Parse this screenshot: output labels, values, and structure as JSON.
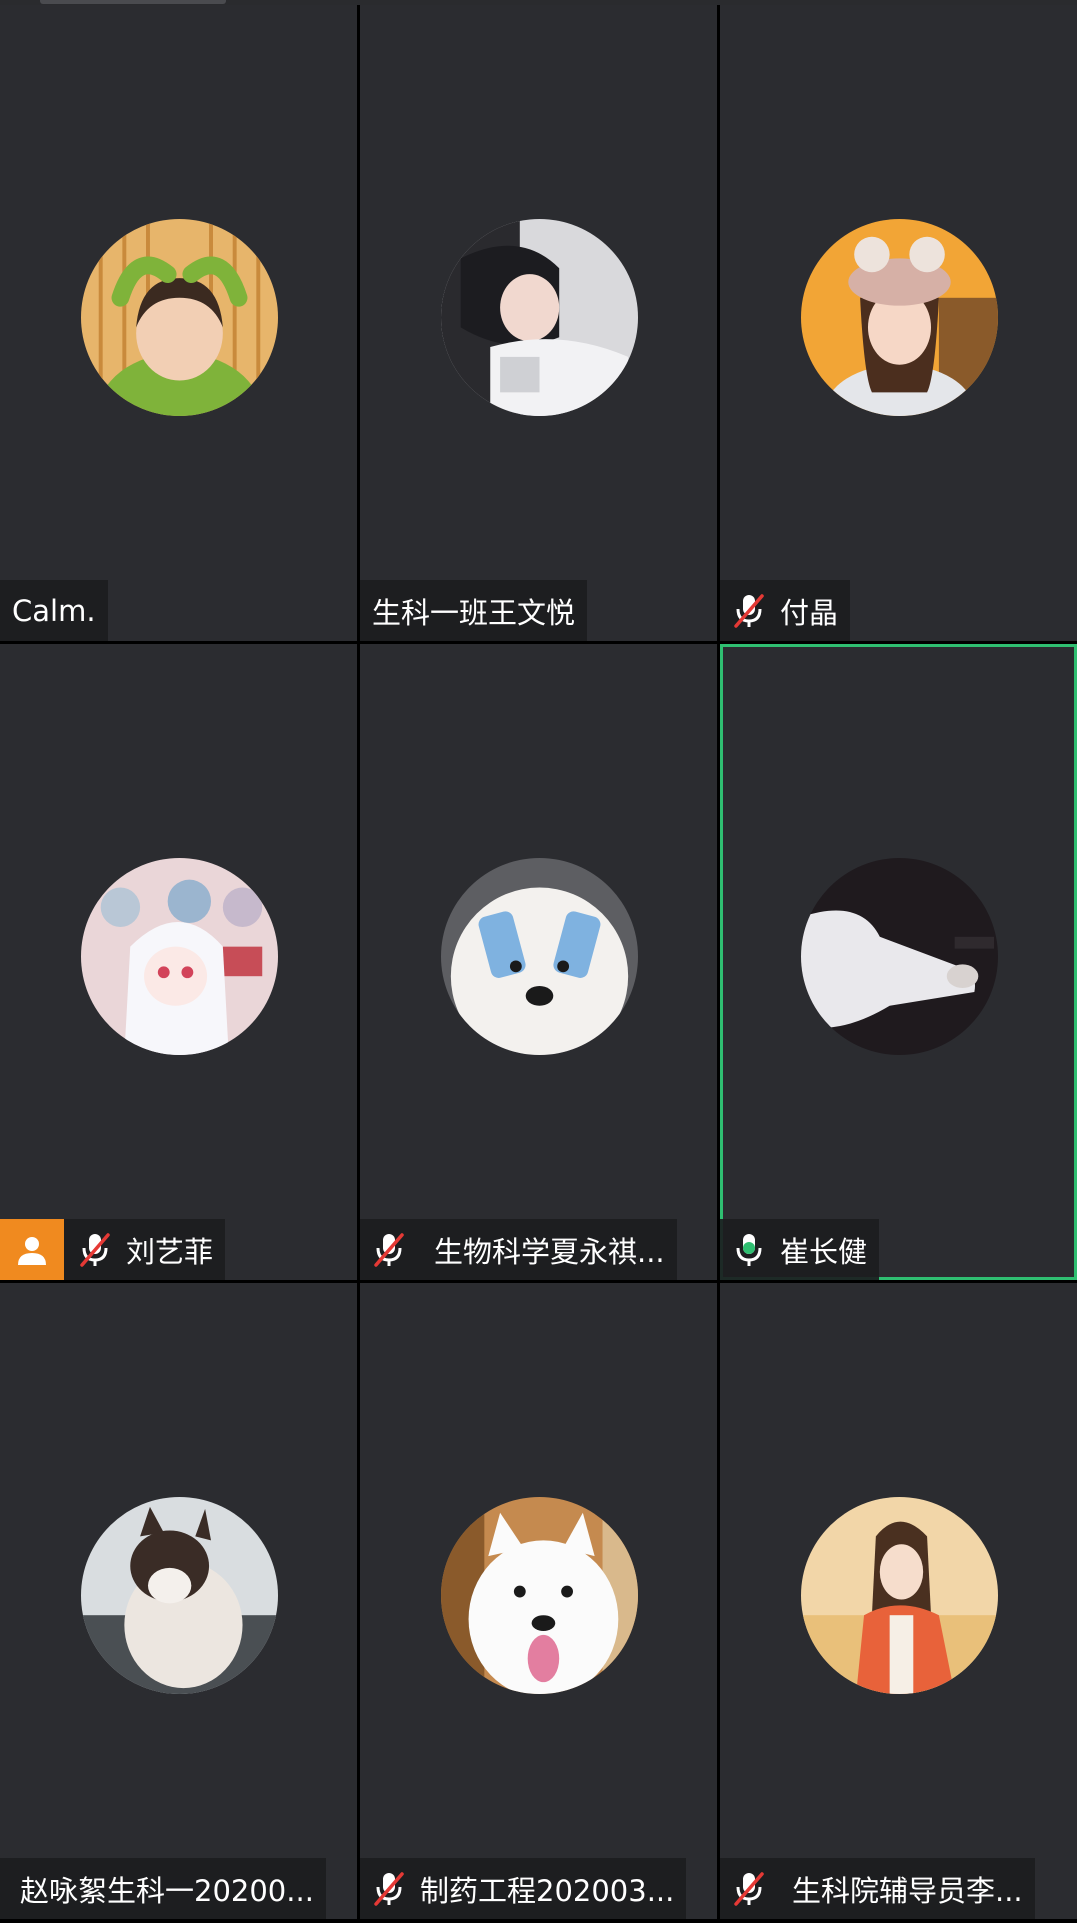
{
  "participants": [
    {
      "name": "Calm.",
      "mic": "none",
      "host": false,
      "speaking": false
    },
    {
      "name": "生科一班王文悦",
      "mic": "none",
      "host": false,
      "speaking": false
    },
    {
      "name": "付晶",
      "mic": "muted",
      "host": false,
      "speaking": false
    },
    {
      "name": "刘艺菲",
      "mic": "muted",
      "host": true,
      "speaking": false
    },
    {
      "name": "生物科学夏永祺...",
      "mic": "muted",
      "host": false,
      "speaking": false
    },
    {
      "name": "崔长健",
      "mic": "active",
      "host": false,
      "speaking": true
    },
    {
      "name": "赵咏絮生科一20200...",
      "mic": "none",
      "host": false,
      "speaking": false
    },
    {
      "name": "制药工程202003...",
      "mic": "muted",
      "host": false,
      "speaking": false
    },
    {
      "name": "生科院辅导员李...",
      "mic": "muted",
      "host": false,
      "speaking": false
    }
  ],
  "icons": {
    "muted": "mic-muted-icon",
    "active": "mic-active-icon",
    "host": "host-icon"
  },
  "colors": {
    "tile_bg": "#2b2c30",
    "speaking_border": "#2fbf71",
    "host_badge": "#f08a1f",
    "muted_slash": "#e53935",
    "mic_active": "#2fbf71"
  }
}
